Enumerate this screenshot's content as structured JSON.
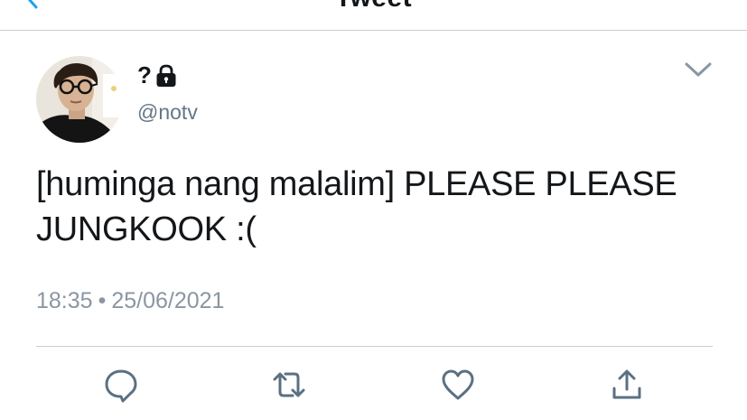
{
  "header": {
    "title": "Tweet",
    "back_icon": "back-arrow-icon"
  },
  "tweet": {
    "display_name": "?",
    "protected_icon": "lock-icon",
    "handle": "@notv",
    "text": "[huminga nang malalim] PLEASE PLEASE JUNGKOOK :(",
    "time": "18:35",
    "separator": "•",
    "date": "25/06/2021",
    "menu_icon": "chevron-down-icon"
  },
  "actions": [
    {
      "name": "reply",
      "icon": "reply-icon"
    },
    {
      "name": "retweet",
      "icon": "retweet-icon"
    },
    {
      "name": "like",
      "icon": "heart-icon"
    },
    {
      "name": "share",
      "icon": "share-icon"
    }
  ],
  "colors": {
    "accent": "#1da1f2",
    "text": "#14171a",
    "secondary": "#657786",
    "icon": "#5b7083",
    "divider": "#c9cdd1"
  }
}
